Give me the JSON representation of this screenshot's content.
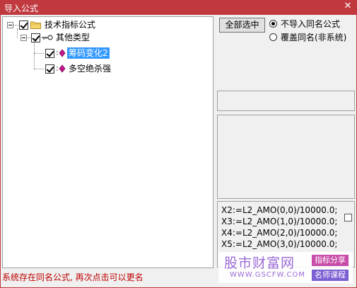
{
  "window": {
    "title": "导入公式",
    "close_glyph": "✕"
  },
  "tree": {
    "root": {
      "label": "技术指标公式",
      "checked": true,
      "icon": "folder-icon"
    },
    "group": {
      "label": "其他类型",
      "checked": true,
      "icon": "key-icon"
    },
    "items": [
      {
        "label": "筹码变化2",
        "checked": true,
        "selected": true,
        "icon": "diamond-icon"
      },
      {
        "label": "多空绝杀强",
        "checked": true,
        "selected": false,
        "icon": "diamond-icon"
      }
    ]
  },
  "actions": {
    "select_all": "全部选中"
  },
  "options": {
    "no_import_same": "不导入同名公式",
    "overwrite_same": "覆盖同名(非系统)",
    "selected": "no_import_same"
  },
  "code_lines": [
    "X2:=L2_AMO(0,0)/10000.0;",
    "X3:=L2_AMO(1,0)/10000.0;",
    "X4:=L2_AMO(2,0)/10000.0;",
    "X5:=L2_AMO(3,0)/10000.0;"
  ],
  "status_message": "系统存在同名公式, 再次点击可以更名",
  "watermark": {
    "brand": "股市财富网",
    "url": "WWW.GSCFW.COM",
    "tag1": "指标分享",
    "tag2": "名师课程"
  },
  "colors": {
    "titlebar": "#c0393f",
    "selection": "#3399ff",
    "status": "#c00000",
    "watermark": "#9b6bd6"
  }
}
